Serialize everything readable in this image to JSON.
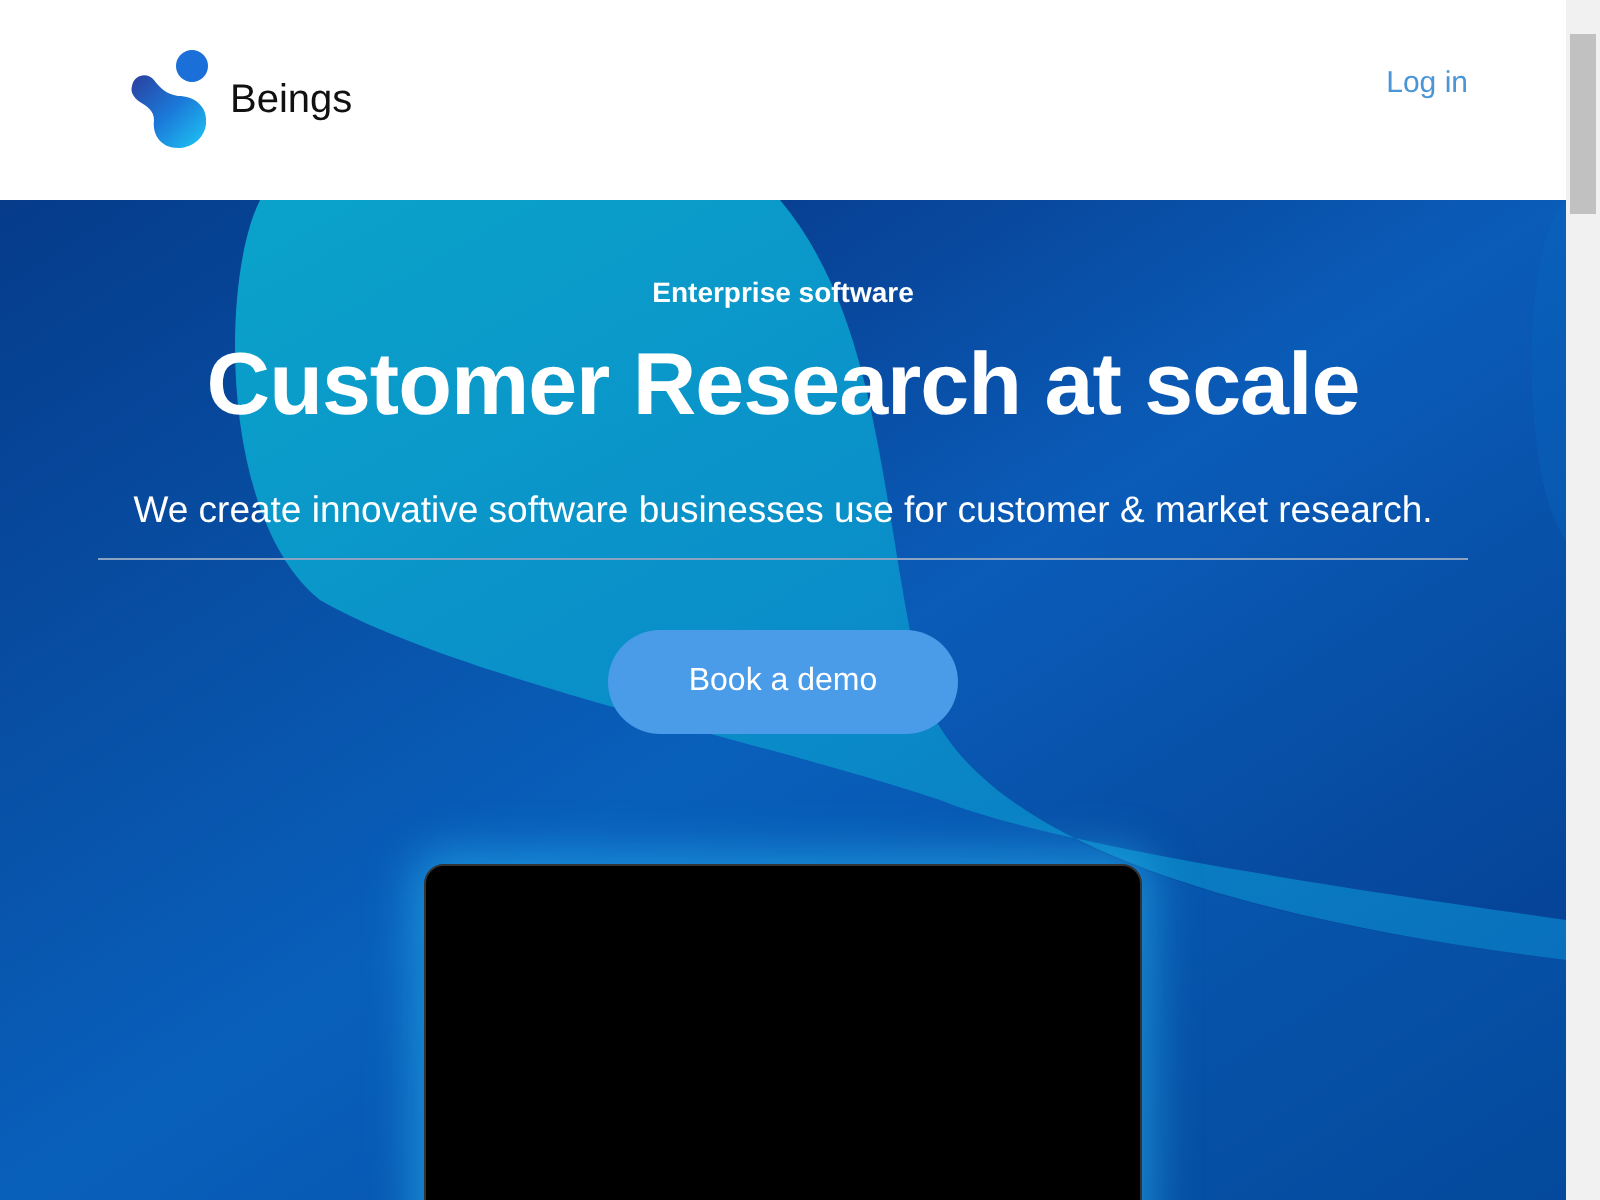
{
  "header": {
    "brand": "Beings",
    "login": "Log in"
  },
  "hero": {
    "eyebrow": "Enterprise software",
    "title": "Customer Research at scale",
    "subtitle": "We create innovative software businesses use for customer & market research.",
    "cta": "Book a demo"
  }
}
